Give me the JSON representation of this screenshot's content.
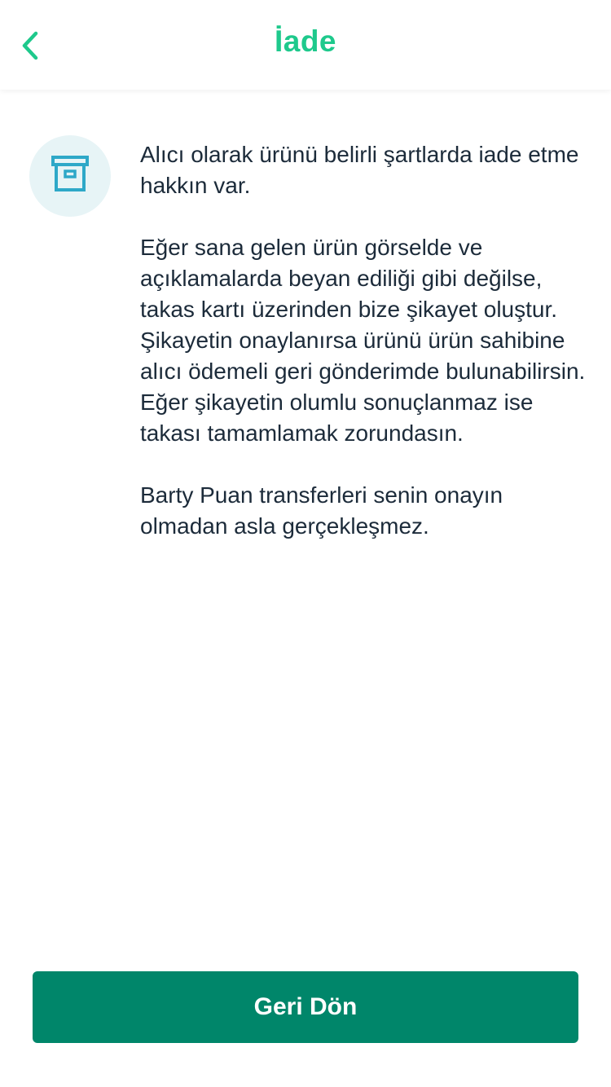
{
  "header": {
    "title": "İade",
    "back_icon": "chevron-left-icon"
  },
  "info": {
    "icon": "archive-box-icon",
    "paragraphs": [
      "Alıcı olarak ürünü belirli şartlarda iade etme hakkın var.",
      "Eğer sana gelen ürün görselde ve açıklamalarda beyan ediliği gibi değilse, takas kartı üzerinden bize şikayet oluştur. Şikayetin onaylanırsa ürünü ürün sahibine alıcı ödemeli geri gönderimde bulunabilirsin. Eğer şikayetin olumlu sonuçlanmaz ise takası tamamlamak zorundasın.",
      "Barty Puan transferleri senin onayın olmadan asla gerçekleşmez."
    ]
  },
  "footer": {
    "button_label": "Geri Dön"
  },
  "colors": {
    "accent": "#1ec98c",
    "primary_button": "#00866a",
    "icon": "#2ea8c8",
    "icon_bg": "#e7f4f6",
    "text": "#1c2b3a"
  }
}
